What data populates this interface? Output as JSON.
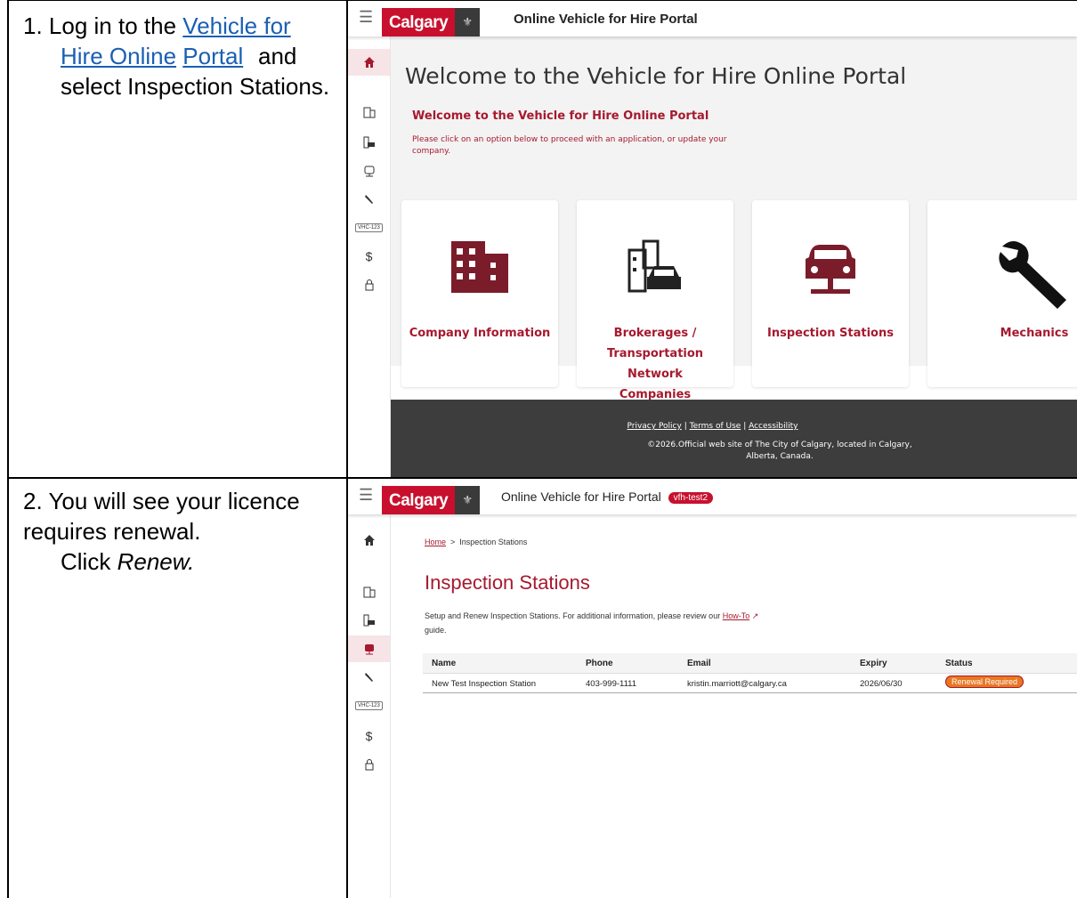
{
  "step1": {
    "number": "1.",
    "text_before": "Log in to the",
    "link1": "Vehicle for",
    "link2": "Hire Online",
    "link3": "Portal",
    "text_after": "and select Inspection Stations."
  },
  "step2": {
    "number": "2.",
    "text": "You will see your licence requires renewal.",
    "click": "Click",
    "renew": "Renew."
  },
  "screen1": {
    "logo": "Calgary",
    "portal_title": "Online Vehicle for Hire Portal",
    "heading": "Welcome to the Vehicle for Hire Online Portal",
    "subheading": "Welcome to the Vehicle for Hire Online Portal",
    "intro": "Please click on an option below to proceed with an application, or update your company.",
    "plate_label": "VHC-123",
    "cards": [
      {
        "label": "Company Information",
        "icon": "building-icon"
      },
      {
        "label": "Brokerages / Transportation Network Companies",
        "icon": "building-car-icon"
      },
      {
        "label": "Inspection Stations",
        "icon": "car-lift-icon"
      },
      {
        "label": "Mechanics",
        "icon": "wrench-icon"
      }
    ],
    "footer": {
      "privacy": "Privacy Policy",
      "terms": "Terms of Use",
      "accessibility": "Accessibility",
      "copyright": "©2026.Official web site of The City of Calgary, located in Calgary, Alberta, Canada."
    }
  },
  "screen2": {
    "logo": "Calgary",
    "portal_title": "Online Vehicle for Hire Portal",
    "env_badge": "vfh-test2",
    "breadcrumb_home": "Home",
    "breadcrumb_current": "Inspection Stations",
    "title": "Inspection Stations",
    "description": "Setup and Renew Inspection Stations. For additional information, please review our",
    "howto": "How-To",
    "description_end": "guide.",
    "plate_label": "VHC-123",
    "table": {
      "headers": [
        "Name",
        "Phone",
        "Email",
        "Expiry",
        "Status"
      ],
      "rows": [
        {
          "name": "New Test Inspection Station",
          "phone": "403-999-1111",
          "email": "kristin.marriott@calgary.ca",
          "expiry": "2026/06/30",
          "status": "Renewal Required"
        }
      ]
    }
  }
}
